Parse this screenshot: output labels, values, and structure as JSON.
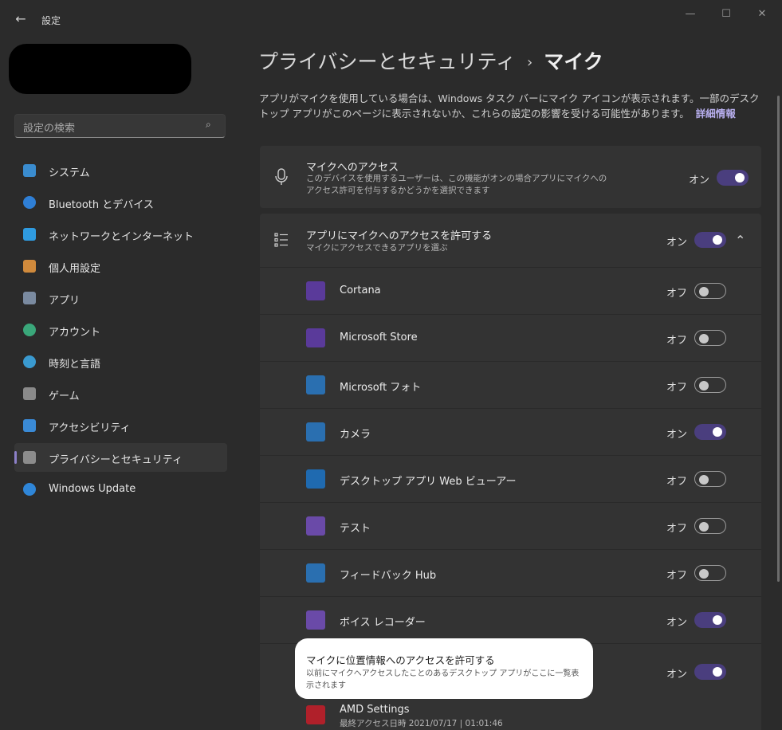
{
  "window": {
    "title": "設定",
    "back_glyph": "←",
    "min_glyph": "—",
    "max_glyph": "☐",
    "close_glyph": "✕"
  },
  "search": {
    "placeholder": "設定の検索",
    "icon_glyph": "⌕"
  },
  "nav": {
    "items": [
      {
        "label": "システム",
        "icon": "system-icon",
        "color": "#3a8ccf"
      },
      {
        "label": "Bluetooth とデバイス",
        "icon": "bluetooth-icon",
        "color": "#2f7fd6"
      },
      {
        "label": "ネットワークとインターネット",
        "icon": "wifi-icon",
        "color": "#2f9be0"
      },
      {
        "label": "個人用設定",
        "icon": "paintbrush-icon",
        "color": "#d08a3c"
      },
      {
        "label": "アプリ",
        "icon": "apps-icon",
        "color": "#7a8aa0"
      },
      {
        "label": "アカウント",
        "icon": "account-icon",
        "color": "#3aa77a"
      },
      {
        "label": "時刻と言語",
        "icon": "globe-clock-icon",
        "color": "#3a9ad0"
      },
      {
        "label": "ゲーム",
        "icon": "gamepad-icon",
        "color": "#8a8a8a"
      },
      {
        "label": "アクセシビリティ",
        "icon": "accessibility-icon",
        "color": "#3a8ad6"
      },
      {
        "label": "プライバシーとセキュリティ",
        "icon": "shield-icon",
        "color": "#8c8c8c",
        "selected": true
      },
      {
        "label": "Windows Update",
        "icon": "windows-update-icon",
        "color": "#2f86d8"
      }
    ]
  },
  "breadcrumb": {
    "parent": "プライバシーとセキュリティ",
    "separator": "›",
    "current": "マイク"
  },
  "description": {
    "text": "アプリがマイクを使用している場合は、Windows タスク バーにマイク アイコンが表示されます。一部のデスクトップ アプリがこのページに表示されないか、これらの設定の影響を受ける可能性があります。",
    "link": "詳細情報"
  },
  "mic_access": {
    "title": "マイクへのアクセス",
    "subtitle": "このデバイスを使用するユーザーは、この機能がオンの場合アプリにマイクへのアクセス許可を付与するかどうかを選択できます",
    "state": "オン",
    "on": true
  },
  "app_access": {
    "title": "アプリにマイクへのアクセスを許可する",
    "subtitle": "マイクにアクセスできるアプリを選ぶ",
    "state": "オン",
    "on": true,
    "chevron": "⌃"
  },
  "apps": [
    {
      "name": "Cortana",
      "state": "オフ",
      "on": false,
      "icon": "cortana-icon",
      "color": "#5a3a9a"
    },
    {
      "name": "Microsoft Store",
      "state": "オフ",
      "on": false,
      "icon": "store-icon",
      "color": "#5a3a9a"
    },
    {
      "name": "Microsoft フォト",
      "state": "オフ",
      "on": false,
      "icon": "photos-icon",
      "color": "#2a6fb0"
    },
    {
      "name": "カメラ",
      "state": "オン",
      "on": true,
      "icon": "camera-icon",
      "color": "#2a6fb0"
    },
    {
      "name": "デスクトップ アプリ Web ビューアー",
      "state": "オフ",
      "on": false,
      "icon": "web-viewer-icon",
      "color": "#1f6ab0"
    },
    {
      "name": "テスト",
      "state": "オフ",
      "on": false,
      "icon": "test-icon",
      "color": "#6a4aa8"
    },
    {
      "name": "フィードバック Hub",
      "state": "オフ",
      "on": false,
      "icon": "feedback-hub-icon",
      "color": "#2a6fb0"
    },
    {
      "name": "ボイス レコーダー",
      "state": "オン",
      "on": true,
      "icon": "voice-recorder-icon",
      "color": "#6a4aa8"
    }
  ],
  "desktop_access": {
    "title": "マイクに位置情報へのアクセスを許可する",
    "subtitle": "以前にマイクへアクセスしたことのあるデスクトップ アプリがここに一覧表示されます",
    "state": "オン",
    "on": true
  },
  "amd": {
    "name": "AMD Settings",
    "last_access": "最終アクセス日時 2021/07/17 | 01:01:46",
    "icon": "amd-icon",
    "color": "#b0202a"
  }
}
